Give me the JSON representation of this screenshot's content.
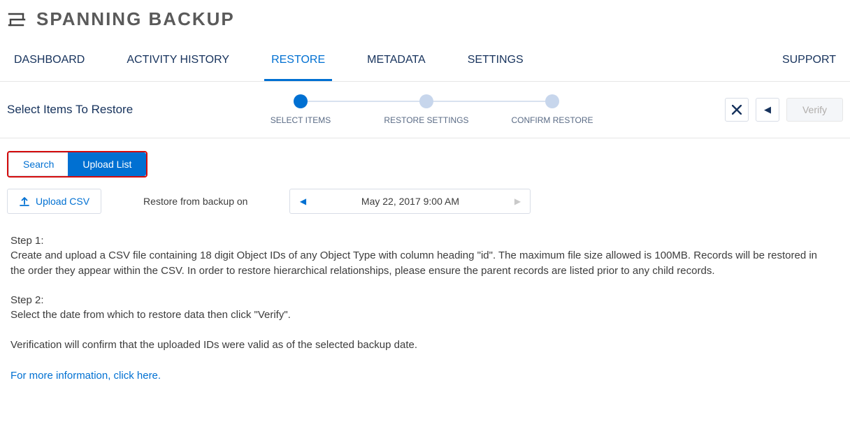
{
  "brand": "SPANNING BACKUP",
  "tabs": {
    "dashboard": "DASHBOARD",
    "activity": "ACTIVITY HISTORY",
    "restore": "RESTORE",
    "metadata": "METADATA",
    "settings": "SETTINGS",
    "support": "SUPPORT"
  },
  "page_title": "Select Items To Restore",
  "stepper": {
    "step1": "SELECT ITEMS",
    "step2": "RESTORE SETTINGS",
    "step3": "CONFIRM RESTORE"
  },
  "actions": {
    "verify": "Verify"
  },
  "toggle": {
    "search": "Search",
    "upload_list": "Upload List"
  },
  "upload_csv": "Upload CSV",
  "restore_from_label": "Restore from backup on",
  "backup_date": "May 22, 2017 9:00 AM",
  "instructions": {
    "step1_h": "Step 1:",
    "step1_t": "Create and upload a CSV file containing 18 digit Object IDs of any Object Type with column heading \"id\". The maximum file size allowed is 100MB. Records will be restored in the order they appear within the CSV. In order to restore hierarchical relationships, please ensure the parent records are listed prior to any child records.",
    "step2_h": "Step 2:",
    "step2_t": "Select the date from which to restore data then click \"Verify\".",
    "step3_t": "Verification will confirm that the uploaded IDs were valid as of the selected backup date.",
    "more_info": "For more information, click here."
  }
}
